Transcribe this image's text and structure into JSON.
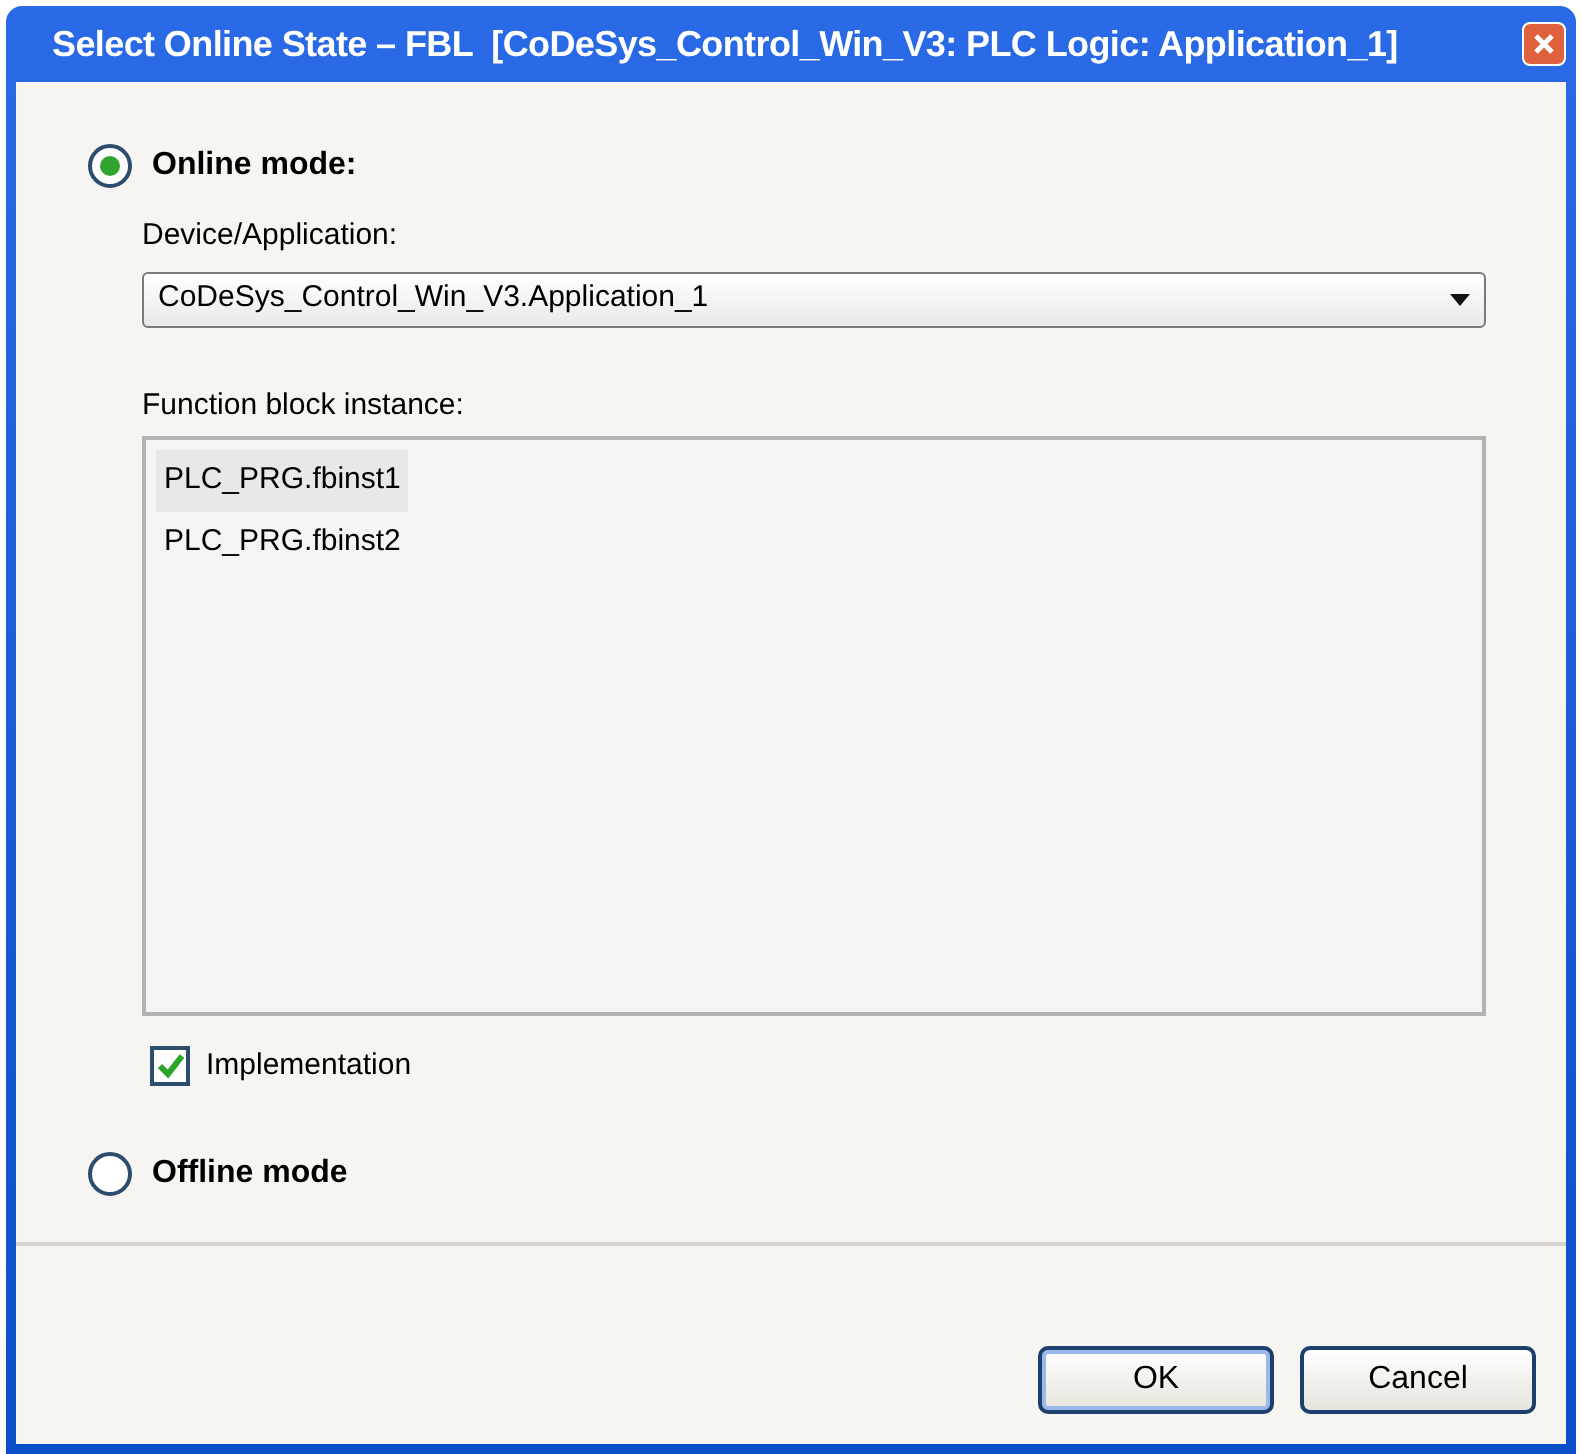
{
  "window": {
    "title": "Select Online State – FBL  [CoDeSys_Control_Win_V3: PLC Logic: Application_1]"
  },
  "online_mode": {
    "label": "Online mode:",
    "selected": true
  },
  "device": {
    "label": "Device/Application:",
    "value": "CoDeSys_Control_Win_V3.Application_1"
  },
  "instances": {
    "label": "Function block instance:",
    "items": [
      {
        "label": "PLC_PRG.fbinst1",
        "selected": true
      },
      {
        "label": "PLC_PRG.fbinst2",
        "selected": false
      }
    ]
  },
  "implementation": {
    "label": "Implementation",
    "checked": true
  },
  "offline_mode": {
    "label": "Offline mode",
    "selected": false
  },
  "buttons": [
    {
      "label": "OK",
      "default": true
    },
    {
      "label": "Cancel",
      "default": false
    }
  ]
}
